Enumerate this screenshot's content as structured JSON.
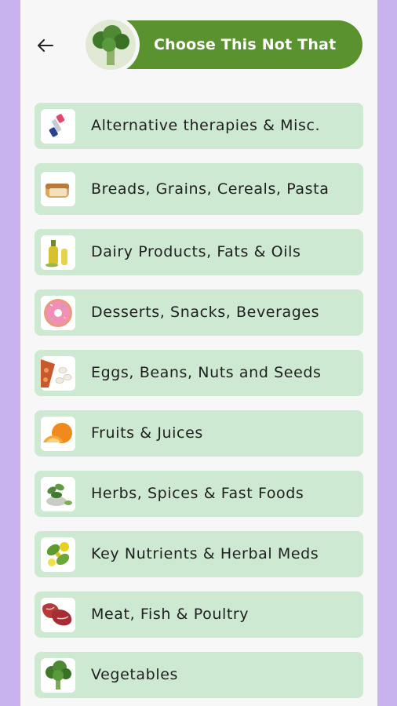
{
  "header": {
    "title": "Choose This Not That",
    "back_icon": "arrow-left-icon",
    "title_image": "broccoli-icon"
  },
  "colors": {
    "background": "#c9b3ef",
    "screen": "#f7f7f7",
    "accent": "#5a9230",
    "item_bg": "#cde9d1"
  },
  "categories": [
    {
      "label": "Alternative therapies & Misc.",
      "icon": "dumbbell-icon"
    },
    {
      "label": "Breads, Grains, Cereals, Pasta",
      "icon": "bread-icon"
    },
    {
      "label": "Dairy Products, Fats & Oils",
      "icon": "oil-bottle-icon"
    },
    {
      "label": "Desserts, Snacks, Beverages",
      "icon": "donut-icon"
    },
    {
      "label": "Eggs, Beans, Nuts and Seeds",
      "icon": "nuts-icon"
    },
    {
      "label": "Fruits & Juices",
      "icon": "orange-icon"
    },
    {
      "label": "Herbs, Spices & Fast Foods",
      "icon": "herbs-icon"
    },
    {
      "label": "Key Nutrients & Herbal Meds",
      "icon": "herbal-icon"
    },
    {
      "label": "Meat, Fish & Poultry",
      "icon": "meat-icon"
    },
    {
      "label": "Vegetables",
      "icon": "broccoli-icon"
    }
  ]
}
